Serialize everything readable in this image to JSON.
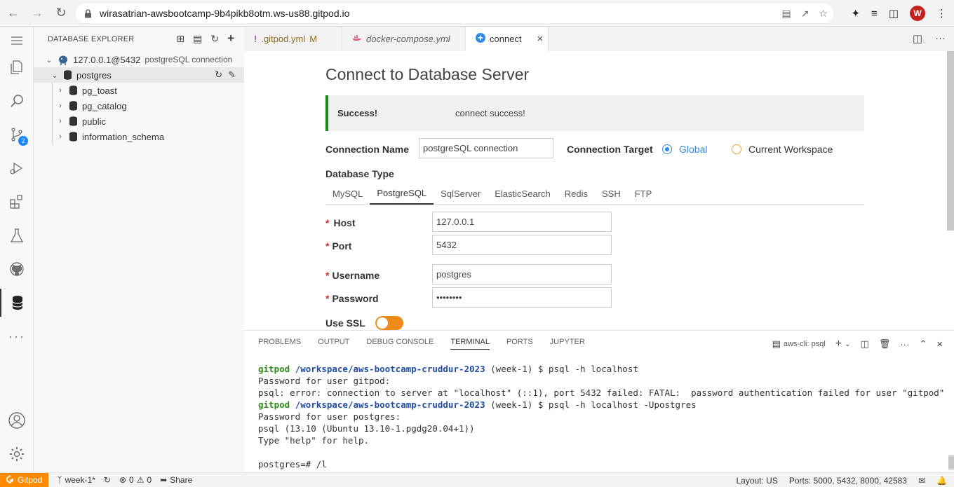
{
  "browser": {
    "url": "wirasatrian-awsbootcamp-9b4pikb8otm.ws-us88.gitpod.io",
    "avatar_letter": "W"
  },
  "activity": {
    "scm_badge": "2"
  },
  "sidebar": {
    "title": "DATABASE EXPLORER",
    "connection": {
      "host": "127.0.0.1@5432",
      "description": "postgreSQL connection"
    },
    "database": "postgres",
    "schemas": [
      "pg_toast",
      "pg_catalog",
      "public",
      "information_schema"
    ]
  },
  "tabs": [
    {
      "label": ".gitpod.yml",
      "badge": "M",
      "icon": "!"
    },
    {
      "label": "docker-compose.yml",
      "icon": "docker-icon"
    },
    {
      "label": "connect",
      "icon": "plus-icon"
    }
  ],
  "form": {
    "title": "Connect to Database Server",
    "alert": {
      "label": "Success!",
      "message": "connect success!"
    },
    "connection_name_label": "Connection Name",
    "connection_name_value": "postgreSQL connection",
    "connection_target_label": "Connection Target",
    "target_global": "Global",
    "target_workspace": "Current Workspace",
    "database_type_label": "Database Type",
    "db_types": [
      "MySQL",
      "PostgreSQL",
      "SqlServer",
      "ElasticSearch",
      "Redis",
      "SSH",
      "FTP"
    ],
    "host_label": "Host",
    "host_value": "127.0.0.1",
    "port_label": "Port",
    "port_value": "5432",
    "username_label": "Username",
    "username_value": "postgres",
    "password_label": "Password",
    "password_value": "••••••••",
    "ssl_label": "Use SSL",
    "required_mark": "*"
  },
  "panel": {
    "tabs": [
      "PROBLEMS",
      "OUTPUT",
      "DEBUG CONSOLE",
      "TERMINAL",
      "PORTS",
      "JUPYTER"
    ],
    "active_tab": "TERMINAL",
    "terminal_name": "aws-cli: psql",
    "lines": {
      "l1_user": "gitpod",
      "l1_path": "/workspace/aws-bootcamp-cruddur-2023",
      "l1_rest": " (week-1) $ psql -h localhost",
      "l2": "Password for user gitpod:",
      "l3": "psql: error: connection to server at \"localhost\" (::1), port 5432 failed: FATAL:  password authentication failed for user \"gitpod\"",
      "l4_user": "gitpod",
      "l4_path": "/workspace/aws-bootcamp-cruddur-2023",
      "l4_rest": " (week-1) $ psql -h localhost -Upostgres",
      "l5": "Password for user postgres:",
      "l6": "psql (13.10 (Ubuntu 13.10-1.pgdg20.04+1))",
      "l7": "Type \"help\" for help.",
      "l8": "",
      "l9": "postgres=# /l"
    }
  },
  "statusbar": {
    "gitpod": "Gitpod",
    "branch": "week-1*",
    "errors": "0",
    "warnings": "0",
    "share": "Share",
    "layout": "Layout: US",
    "ports": "Ports: 5000, 5432, 8000, 42583"
  }
}
